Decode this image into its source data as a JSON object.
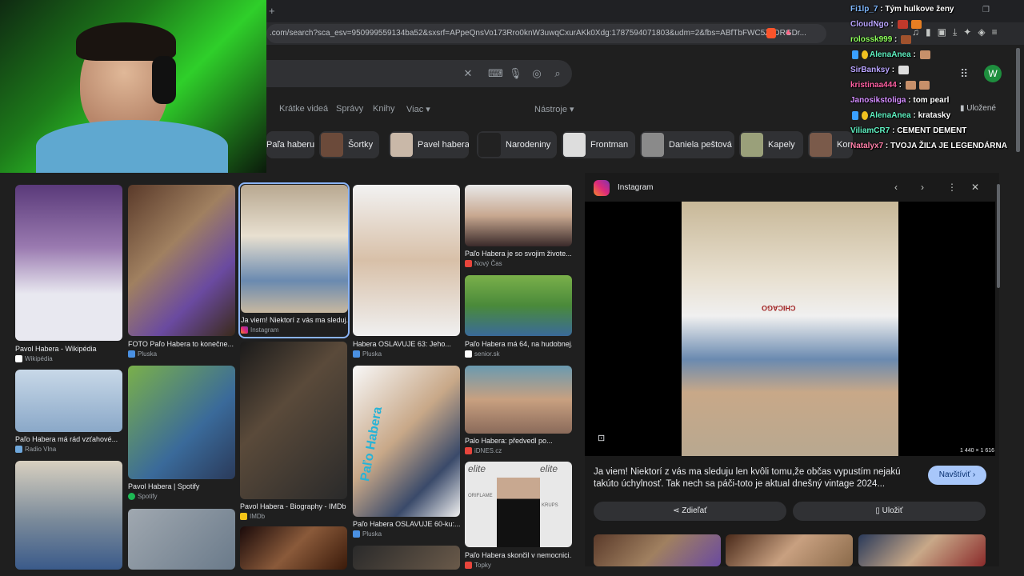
{
  "browser": {
    "url": ".com/search?sca_esv=950999559134ba52&sxsrf=APpeQnsVo173Rro0knW3uwqCxurAKk0Xdg:1787594071803&udm=2&fbs=ABfTbFWC5ZJDRGDr...",
    "new_tab": "+",
    "avatar_letter": "W",
    "saved_label": "Uložené"
  },
  "search": {
    "nav_tabs": [
      "Krátke videá",
      "Správy",
      "Knihy",
      "Viac"
    ],
    "tools_label": "Nástroje",
    "chips": [
      "Paľa haberu",
      "Šortky",
      "Pavel habera",
      "Narodeniny",
      "Frontman",
      "Daniela peštová",
      "Kapely",
      "Kor"
    ]
  },
  "results": [
    {
      "title": "Pavol Habera - Wikipédia",
      "source": "Wikipédia"
    },
    {
      "title": "FOTO Paľo Habera to konečne...",
      "source": "Pluska"
    },
    {
      "title": "Ja viem! Niektorí z vás ma sleduj...",
      "source": "Instagram"
    },
    {
      "title": "Habera OSLAVUJE 63: Jeho...",
      "source": "Pluska"
    },
    {
      "title": "Paľo Habera je so svojim živote...",
      "source": "Nový Čas"
    },
    {
      "title": "Paľo Habera má 64, na hudobnej...",
      "source": "senior.sk"
    },
    {
      "title": "Paľo Habera má rád vzťahové...",
      "source": "Radio Vlna"
    },
    {
      "title": "Pavol Habera | Spotify",
      "source": "Spotify"
    },
    {
      "title": "Pavol Habera - Biography - IMDb",
      "source": "IMDb"
    },
    {
      "title": "Paľo Habera OSLAVUJE 60-ku:...",
      "source": "Pluska"
    },
    {
      "title": "Palo Habera: předvedl po...",
      "source": "iDNES.cz"
    },
    {
      "title": "Paľo Habera skončil v nemocnici...",
      "source": "Topky"
    }
  ],
  "image_texts": {
    "palo_habera_poster": "Paľo Habera",
    "shirt_print": "CHICAGO",
    "elite_1": "elite",
    "elite_2": "elite",
    "oriflame": "ORIFLAME",
    "krups": "KRUPS"
  },
  "preview": {
    "site_name": "Instagram",
    "dimensions": "1 440 × 1 616",
    "description": "Ja viem! Niektorí z vás ma sleduju len kvôli tomu,že občas vypustím nejakú takúto úchylnosť. Tak nech sa páči-toto je aktual dnešný vintage 2024...",
    "visit_label": "Navštíviť",
    "share_label": "Zdieľať",
    "save_label": "Uložiť"
  },
  "chat": [
    {
      "user": "Fi1lp_7",
      "text": "Tým hulkove ženy",
      "color": "#7fb8ff"
    },
    {
      "user": "CloudNgo",
      "text": "",
      "color": "#b9a4ff"
    },
    {
      "user": "rolossk999",
      "text": "",
      "color": "#8cff5a"
    },
    {
      "user": "AlenaAnea",
      "text": "",
      "color": "#5ef0c0"
    },
    {
      "user": "SirBanksy",
      "text": "",
      "color": "#b9a4ff"
    },
    {
      "user": "kristinaa444",
      "text": "",
      "color": "#ff5fa2"
    },
    {
      "user": "Janosikstoliga",
      "text": "tom pearl",
      "color": "#d38cff"
    },
    {
      "user": "AlenaAnea",
      "text": "kratasky",
      "color": "#5ef0c0"
    },
    {
      "user": "ViliamCR7",
      "text": "CEMENT DEMENT",
      "color": "#5ef0c0"
    },
    {
      "user": "Natalyx7",
      "text": "TVOJA ŽIĽA JE LEGENDÁRNA",
      "color": "#ff7fa8"
    }
  ],
  "colors": {
    "accent": "#8ab4f8",
    "avatar": "#1e8e3e",
    "visit_btn": "#a8c7fa"
  }
}
